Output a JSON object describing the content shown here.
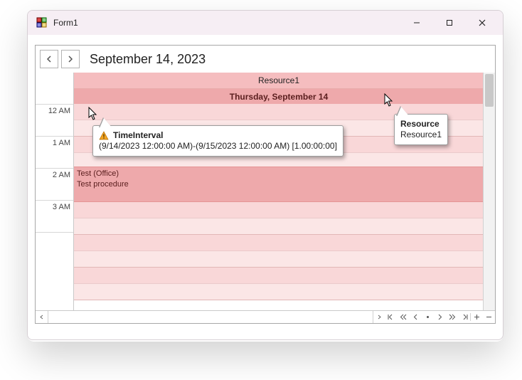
{
  "window": {
    "title": "Form1"
  },
  "header": {
    "date_title": "September 14, 2023"
  },
  "scheduler": {
    "resource_header": "Resource1",
    "day_header": "Thursday, September 14",
    "time_labels": [
      "12 AM",
      "1 AM",
      "2 AM",
      "3 AM"
    ],
    "appointment": {
      "line1": "Test (Office)",
      "line2": "Test procedure"
    }
  },
  "tooltip_interval": {
    "title": "TimeInterval",
    "detail": "(9/14/2023 12:00:00 AM)-(9/15/2023 12:00:00 AM) [1.00:00:00]"
  },
  "tooltip_resource": {
    "title": "Resource",
    "detail": "Resource1"
  }
}
